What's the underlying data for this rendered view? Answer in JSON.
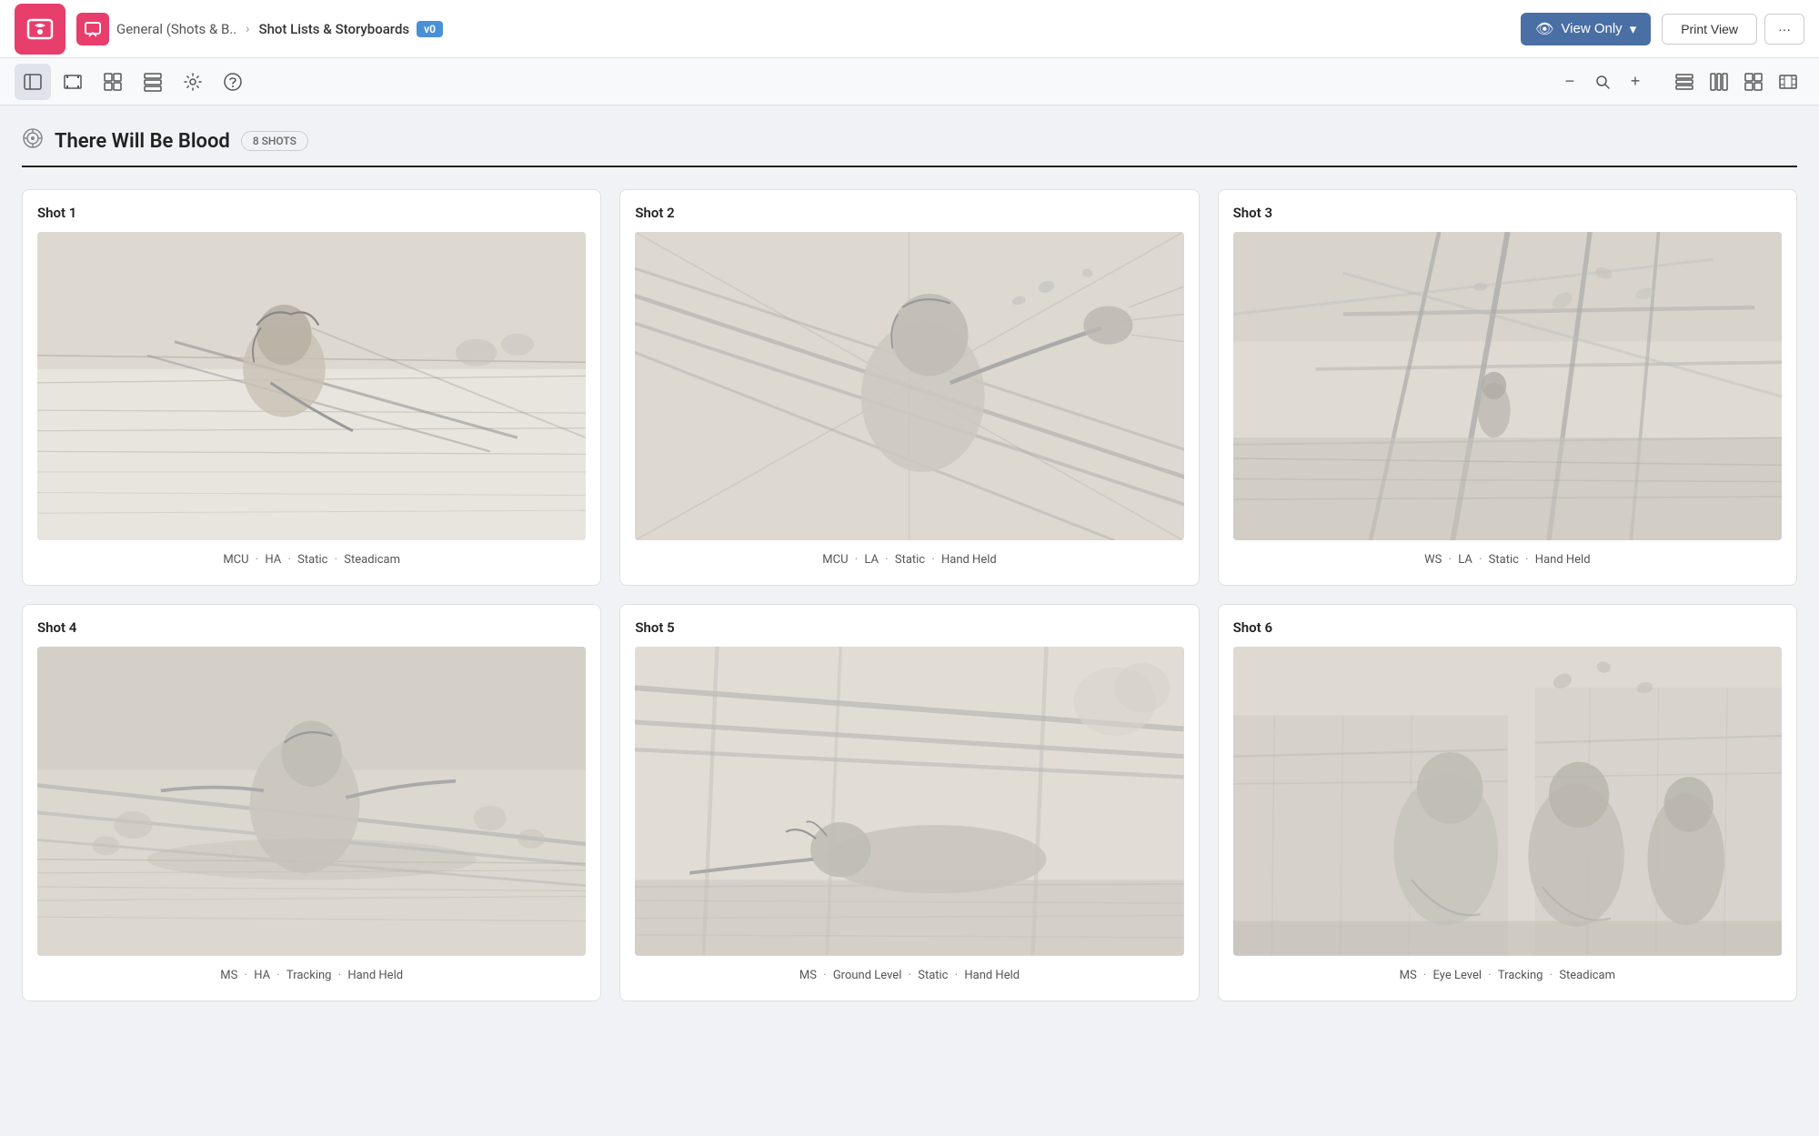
{
  "appLogo": {
    "alt": "ShotGrid App"
  },
  "topNav": {
    "navIcon": "chat-icon",
    "breadcrumb": {
      "parent": "General (Shots & B..",
      "separator": ">",
      "current": "Shot Lists & Storyboards",
      "version": "v0"
    },
    "viewOnlyLabel": "View Only",
    "printViewLabel": "Print View",
    "moreLabel": "···"
  },
  "toolbar": {
    "buttons": [
      {
        "name": "sidebar-toggle-btn",
        "icon": "⊞",
        "label": "Sidebar"
      },
      {
        "name": "film-strip-btn",
        "icon": "◻",
        "label": "Film Strip"
      },
      {
        "name": "grid-btn",
        "icon": "⊞",
        "label": "Grid"
      },
      {
        "name": "list-btn",
        "icon": "☰",
        "label": "List"
      },
      {
        "name": "settings-btn",
        "icon": "⚙",
        "label": "Settings"
      },
      {
        "name": "help-btn",
        "icon": "?",
        "label": "Help"
      }
    ],
    "zoomMinus": "−",
    "zoomIcon": "🔍",
    "zoomPlus": "+",
    "viewModes": [
      {
        "name": "view-rows-btn",
        "icon": "rows"
      },
      {
        "name": "view-columns-btn",
        "icon": "columns"
      },
      {
        "name": "view-grid-btn",
        "icon": "grid"
      },
      {
        "name": "view-film-btn",
        "icon": "film"
      }
    ]
  },
  "scene": {
    "title": "There Will Be Blood",
    "shotCount": "8 SHOTS",
    "icon": "🎯"
  },
  "shots": [
    {
      "id": "shot-1",
      "label": "Shot 1",
      "tags": [
        "MCU",
        "HA",
        "Static",
        "Steadicam"
      ],
      "sketchClass": "sketch-1"
    },
    {
      "id": "shot-2",
      "label": "Shot 2",
      "tags": [
        "MCU",
        "LA",
        "Static",
        "Hand Held"
      ],
      "sketchClass": "sketch-2"
    },
    {
      "id": "shot-3",
      "label": "Shot 3",
      "tags": [
        "WS",
        "LA",
        "Static",
        "Hand Held"
      ],
      "sketchClass": "sketch-3"
    },
    {
      "id": "shot-4",
      "label": "Shot 4",
      "tags": [
        "MS",
        "HA",
        "Tracking",
        "Hand Held"
      ],
      "sketchClass": "sketch-4"
    },
    {
      "id": "shot-5",
      "label": "Shot 5",
      "tags": [
        "MS",
        "Ground Level",
        "Static",
        "Hand Held"
      ],
      "sketchClass": "sketch-5"
    },
    {
      "id": "shot-6",
      "label": "Shot 6",
      "tags": [
        "MS",
        "Eye Level",
        "Tracking",
        "Steadicam"
      ],
      "sketchClass": "sketch-6"
    }
  ]
}
